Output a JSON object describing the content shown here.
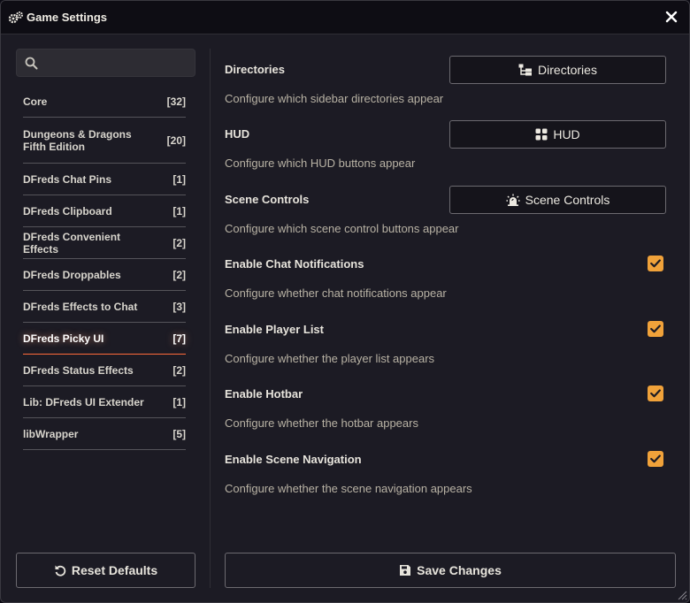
{
  "window": {
    "title": "Game Settings"
  },
  "search": {
    "value": "",
    "placeholder": ""
  },
  "categories": [
    {
      "label": "Core",
      "count": "[32]",
      "active": false
    },
    {
      "label": "Dungeons & Dragons Fifth Edition",
      "count": "[20]",
      "active": false
    },
    {
      "label": "DFreds Chat Pins",
      "count": "[1]",
      "active": false
    },
    {
      "label": "DFreds Clipboard",
      "count": "[1]",
      "active": false
    },
    {
      "label": "DFreds Convenient Effects",
      "count": "[2]",
      "active": false
    },
    {
      "label": "DFreds Droppables",
      "count": "[2]",
      "active": false
    },
    {
      "label": "DFreds Effects to Chat",
      "count": "[3]",
      "active": false
    },
    {
      "label": "DFreds Picky UI",
      "count": "[7]",
      "active": true
    },
    {
      "label": "DFreds Status Effects",
      "count": "[2]",
      "active": false
    },
    {
      "label": "Lib: DFreds UI Extender",
      "count": "[1]",
      "active": false
    },
    {
      "label": "libWrapper",
      "count": "[5]",
      "active": false
    }
  ],
  "settings": [
    {
      "name": "Directories",
      "desc": "Configure which sidebar directories appear",
      "type": "menu",
      "button_label": "Directories",
      "icon": "folder-tree-icon"
    },
    {
      "name": "HUD",
      "desc": "Configure which HUD buttons appear",
      "type": "menu",
      "button_label": "HUD",
      "icon": "grid-icon"
    },
    {
      "name": "Scene Controls",
      "desc": "Configure which scene control buttons appear",
      "type": "menu",
      "button_label": "Scene Controls",
      "icon": "alarm-light-icon"
    },
    {
      "name": "Enable Chat Notifications",
      "desc": "Configure whether chat notifications appear",
      "type": "checkbox",
      "checked": true
    },
    {
      "name": "Enable Player List",
      "desc": "Configure whether the player list appears",
      "type": "checkbox",
      "checked": true
    },
    {
      "name": "Enable Hotbar",
      "desc": "Configure whether the hotbar appears",
      "type": "checkbox",
      "checked": true
    },
    {
      "name": "Enable Scene Navigation",
      "desc": "Configure whether the scene navigation appears",
      "type": "checkbox",
      "checked": true
    }
  ],
  "footer": {
    "reset_label": "Reset Defaults",
    "save_label": "Save Changes"
  },
  "colors": {
    "accent": "#f0a23a",
    "active_underline": "#ff6a3a",
    "background": "#1c1b24"
  }
}
